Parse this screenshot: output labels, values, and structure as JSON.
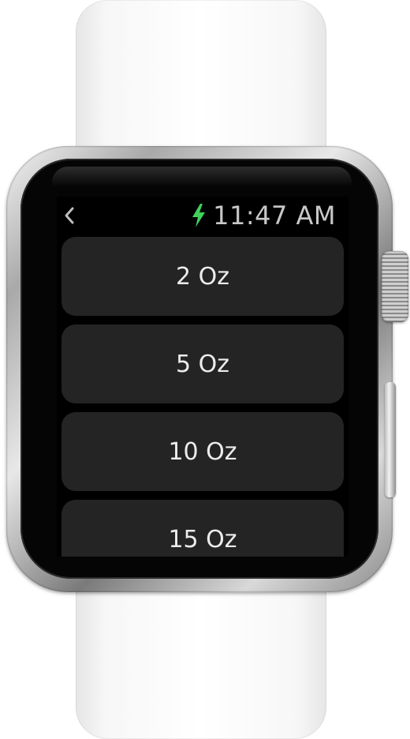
{
  "status_bar": {
    "back_icon": "chevron-left-icon",
    "charging_icon": "lightning-bolt-icon",
    "charging_color": "#3fd05a",
    "time": "11:47 AM"
  },
  "amount_list": {
    "items": [
      {
        "label": "2 Oz"
      },
      {
        "label": "5 Oz"
      },
      {
        "label": "10 Oz"
      },
      {
        "label": "15 Oz"
      }
    ]
  },
  "colors": {
    "screen_background": "#000000",
    "row_background": "#242424",
    "row_text": "#ececec",
    "time_text": "#c8c8c8"
  }
}
